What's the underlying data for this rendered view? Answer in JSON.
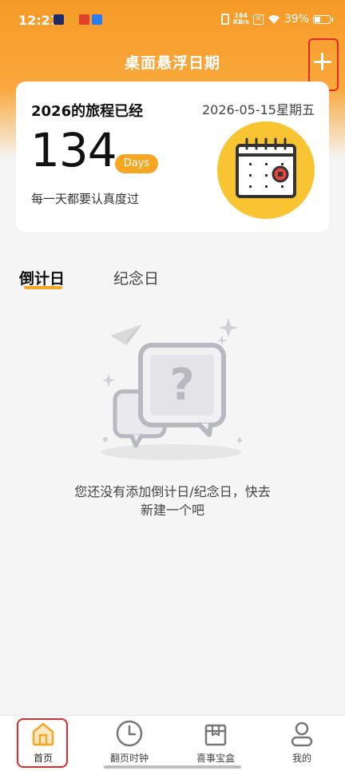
{
  "status_bar": {
    "time": "12:21",
    "net_speed_top": "164",
    "net_speed_unit": "KB/s",
    "battery": "39%"
  },
  "header": {
    "title": "桌面悬浮日期",
    "add_icon": "plus-icon"
  },
  "summary_card": {
    "year_label": "2026的旅程已经",
    "date": "2026-05-15星期五",
    "days_count": "134",
    "days_unit": "Days",
    "motto": "每一天都要认真度过",
    "illustration_icon": "calendar-icon"
  },
  "tabs": [
    {
      "label": "倒计日",
      "active": true
    },
    {
      "label": "纪念日",
      "active": false
    }
  ],
  "empty_state": {
    "line1": "您还没有添加倒计日/纪念日，快去",
    "line2": "新建一个吧",
    "icon": "question-chat-icon"
  },
  "bottom_nav": [
    {
      "label": "首页",
      "icon": "home-icon",
      "active": true
    },
    {
      "label": "翻页时钟",
      "icon": "clock-icon",
      "active": false
    },
    {
      "label": "喜事宝盒",
      "icon": "box-icon",
      "active": false
    },
    {
      "label": "我的",
      "icon": "user-icon",
      "active": false
    }
  ],
  "colors": {
    "accent": "#f5a623",
    "header_top": "#f79a28",
    "highlight_box": "#e12a2a",
    "calendar_circle": "#f9c431"
  }
}
